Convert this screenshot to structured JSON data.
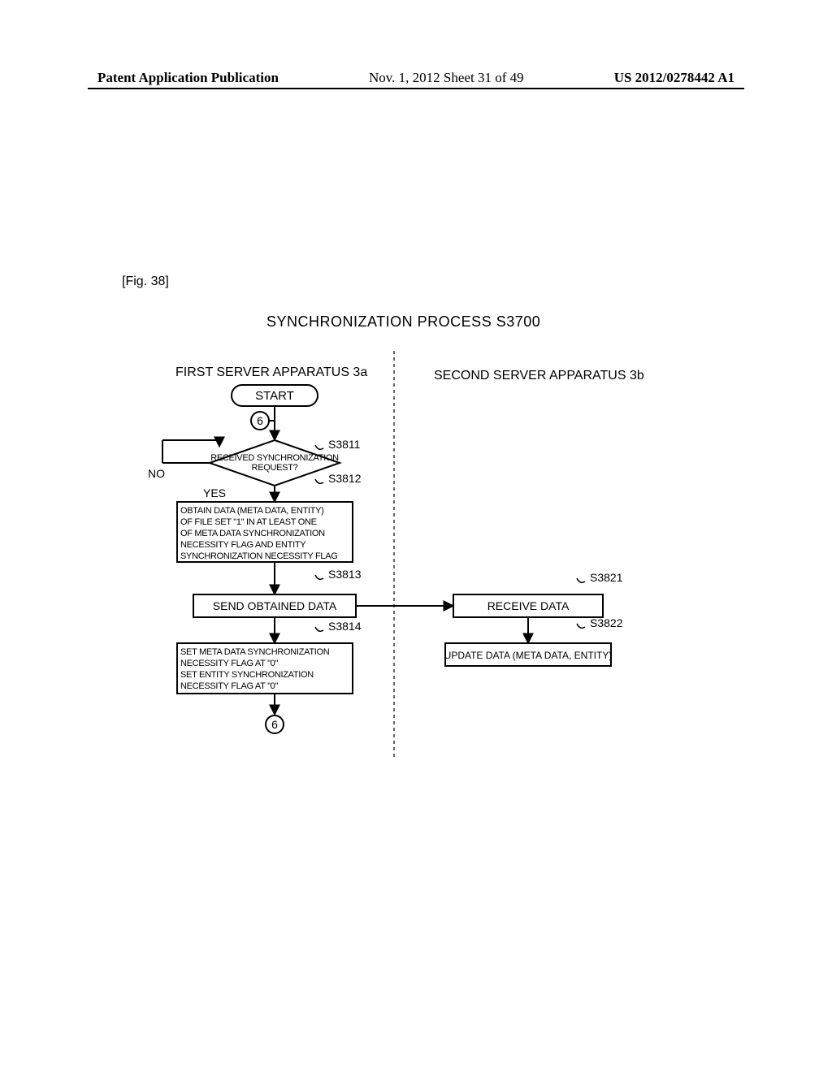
{
  "header": {
    "left": "Patent Application Publication",
    "center": "Nov. 1, 2012  Sheet 31 of 49",
    "right": "US 2012/0278442 A1"
  },
  "figure_label": "[Fig. 38]",
  "process_title": "SYNCHRONIZATION PROCESS S3700",
  "columns": {
    "left": "FIRST SERVER APPARATUS 3a",
    "right": "SECOND SERVER APPARATUS 3b"
  },
  "flow": {
    "start": "START",
    "conn": "6",
    "q_sync": "RECEIVED SYNCHRONIZATION REQUEST?",
    "q_no": "NO",
    "q_yes": "YES",
    "s3811": "S3811",
    "s3812": "S3812",
    "s3813": "S3813",
    "s3814": "S3814",
    "s3821": "S3821",
    "s3822": "S3822",
    "obtain": [
      "OBTAIN DATA (META DATA, ENTITY)",
      "OF FILE SET \"1\" IN AT LEAST ONE",
      "OF META DATA SYNCHRONIZATION",
      "NECESSITY FLAG AND ENTITY",
      "SYNCHRONIZATION NECESSITY FLAG"
    ],
    "send": "SEND OBTAINED DATA",
    "setflags": [
      "SET META DATA SYNCHRONIZATION",
      "NECESSITY FLAG AT \"0\"",
      "SET ENTITY SYNCHRONIZATION",
      "NECESSITY FLAG AT \"0\""
    ],
    "receive": "RECEIVE DATA",
    "update": "UPDATE DATA (META DATA, ENTITY)"
  }
}
